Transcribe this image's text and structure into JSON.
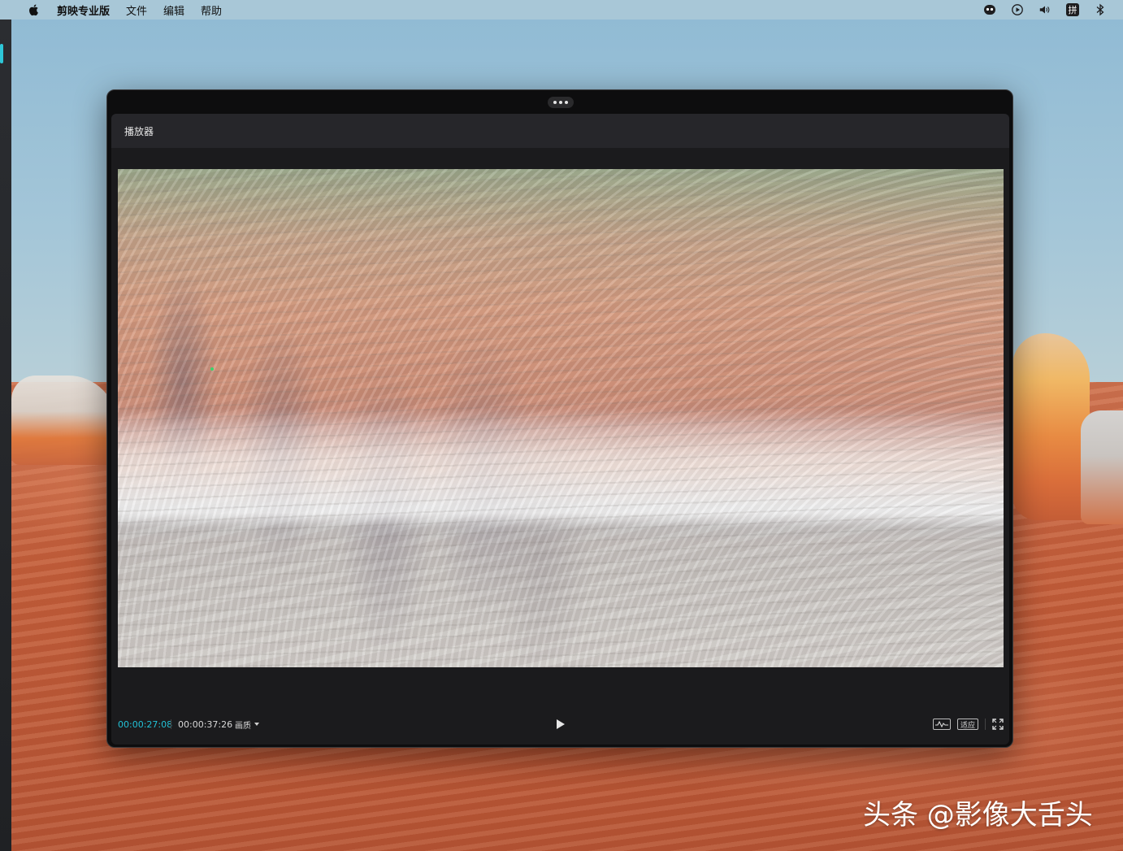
{
  "menubar": {
    "app_name": "剪映专业版",
    "items": [
      "文件",
      "编辑",
      "帮助"
    ],
    "ime_label": "拼"
  },
  "window": {
    "panel_title": "播放器"
  },
  "player": {
    "current_time": "00:00:27:08",
    "total_time": "00:00:37:26",
    "quality_label": "画质",
    "fit_label": "适应",
    "accent_color": "#22c1d6"
  },
  "watermark": {
    "text": "头条 @影像大舌头"
  },
  "icons": {
    "menubar_left": "apple-icon",
    "menubar_right": [
      "status-face-icon",
      "play-circle-icon",
      "volume-icon",
      "input-method-icon",
      "bluetooth-icon"
    ],
    "controls": [
      "play-icon",
      "waveform-icon",
      "fullscreen-icon"
    ]
  }
}
